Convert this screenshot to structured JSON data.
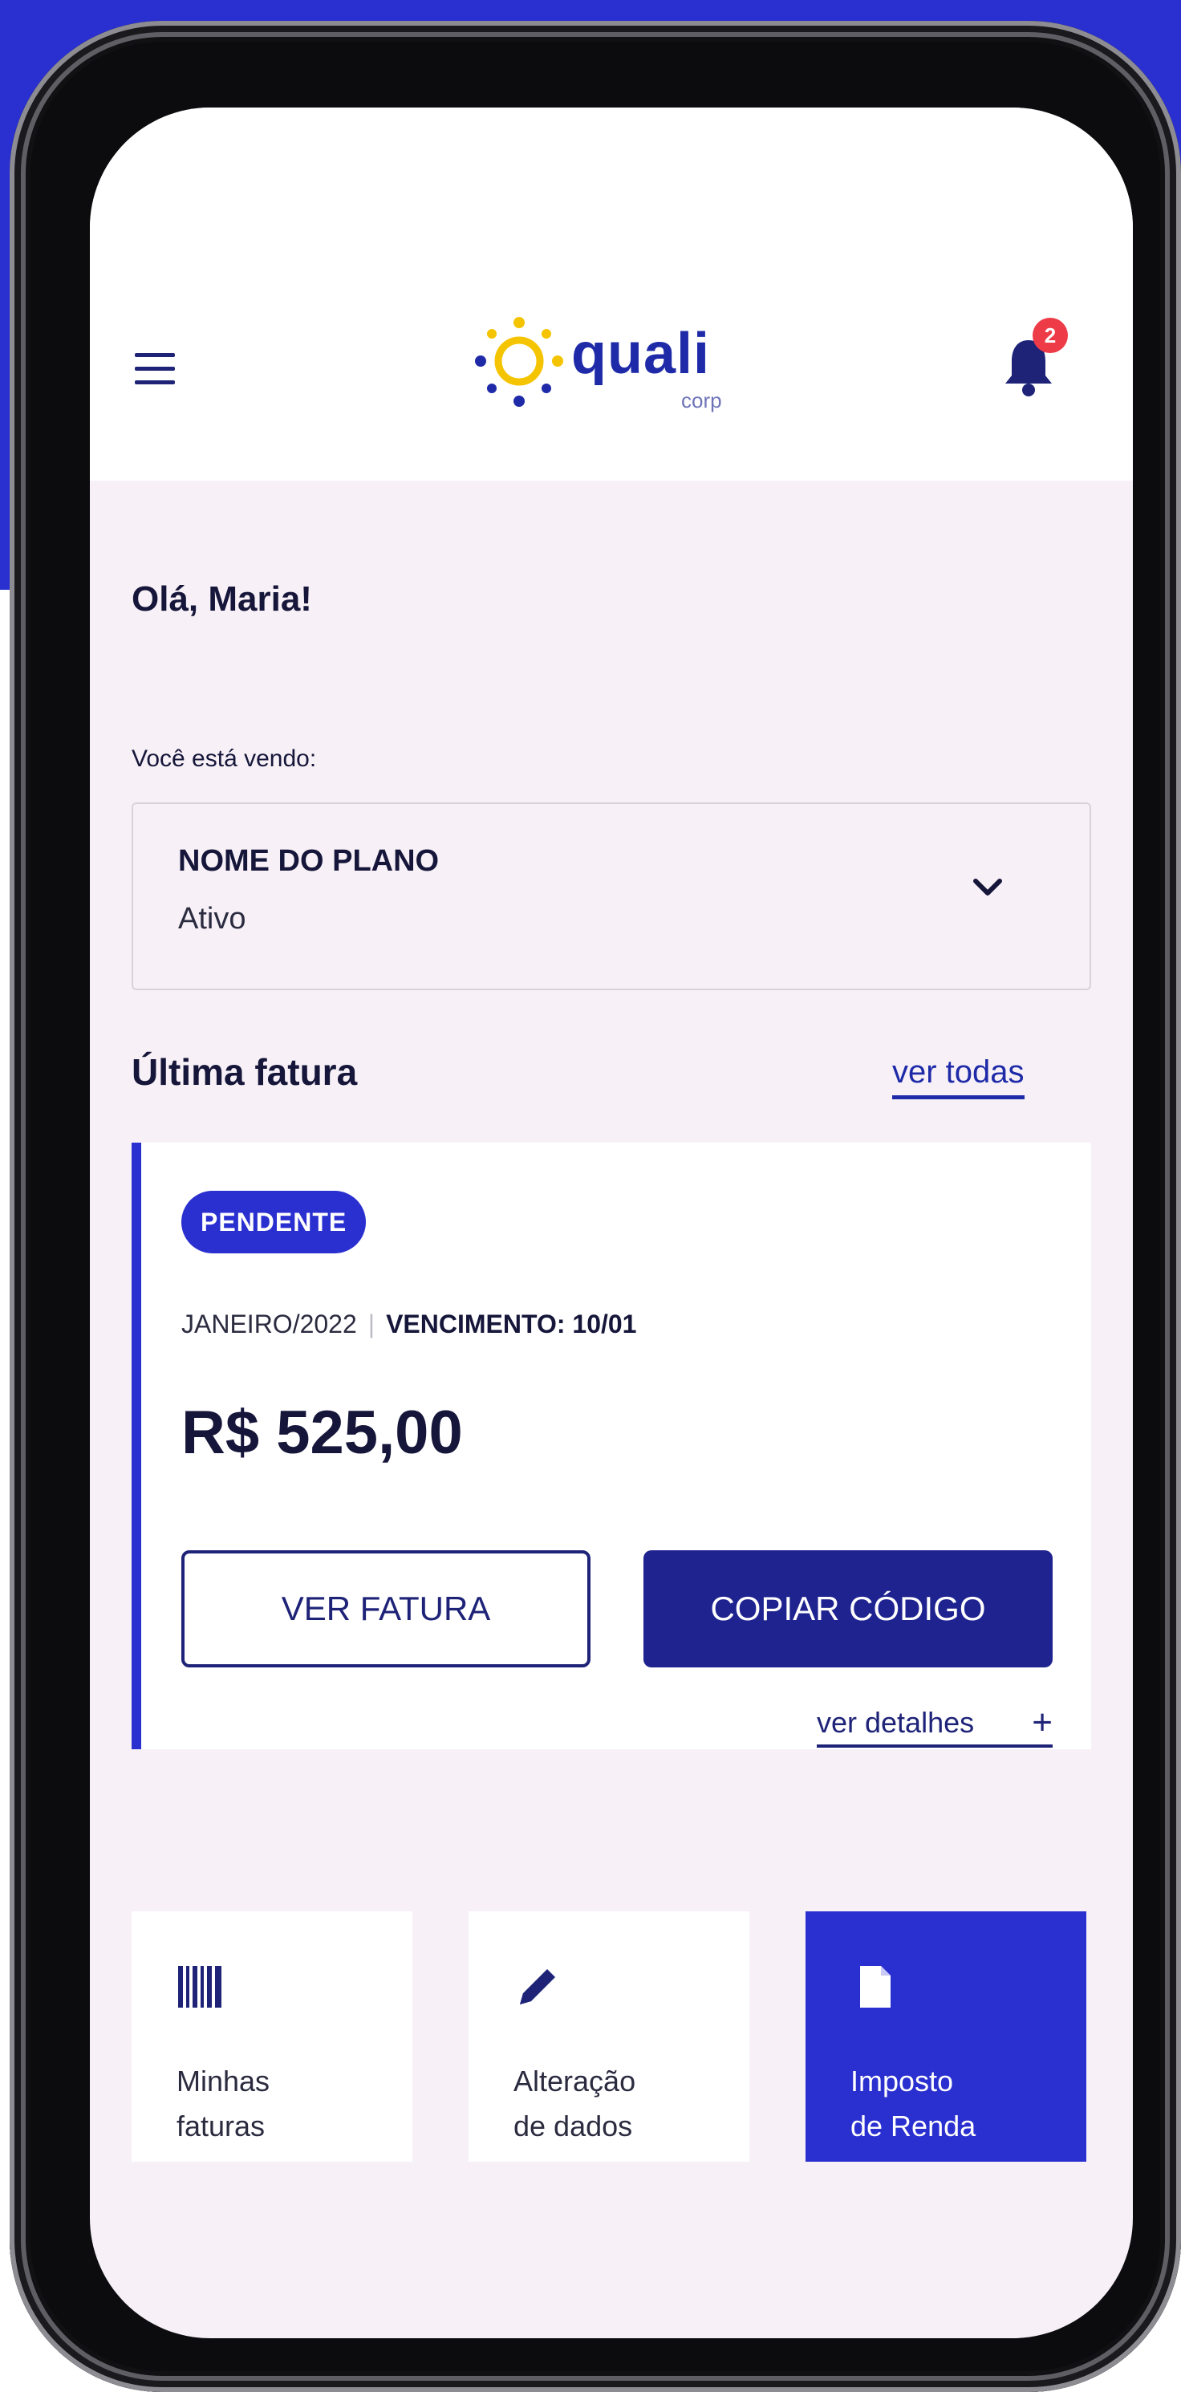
{
  "header": {
    "logo_text": "quali",
    "logo_sub": "corp",
    "notification_count": "2"
  },
  "greeting": "Olá, Maria!",
  "plan": {
    "label": "Você está vendo:",
    "name": "NOME DO PLANO",
    "status": "Ativo"
  },
  "last_invoice": {
    "section_title": "Última fatura",
    "see_all": "ver todas",
    "status_badge": "PENDENTE",
    "period": "JANEIRO/2022",
    "due": "VENCIMENTO: 10/01",
    "amount": "R$ 525,00",
    "view_button": "VER FATURA",
    "copy_button": "COPIAR CÓDIGO",
    "details_link": "ver detalhes",
    "details_plus": "+"
  },
  "tiles": [
    {
      "line1": "Minhas",
      "line2": "faturas",
      "icon": "barcode-icon"
    },
    {
      "line1": "Alteração",
      "line2": "de dados",
      "icon": "pencil-icon"
    },
    {
      "line1": "Imposto",
      "line2": "de Renda",
      "icon": "document-icon"
    }
  ],
  "colors": {
    "brand_blue": "#2a2fd0",
    "navy": "#1e2390",
    "badge_red": "#ee3b48",
    "sun_yellow": "#f5c400"
  }
}
